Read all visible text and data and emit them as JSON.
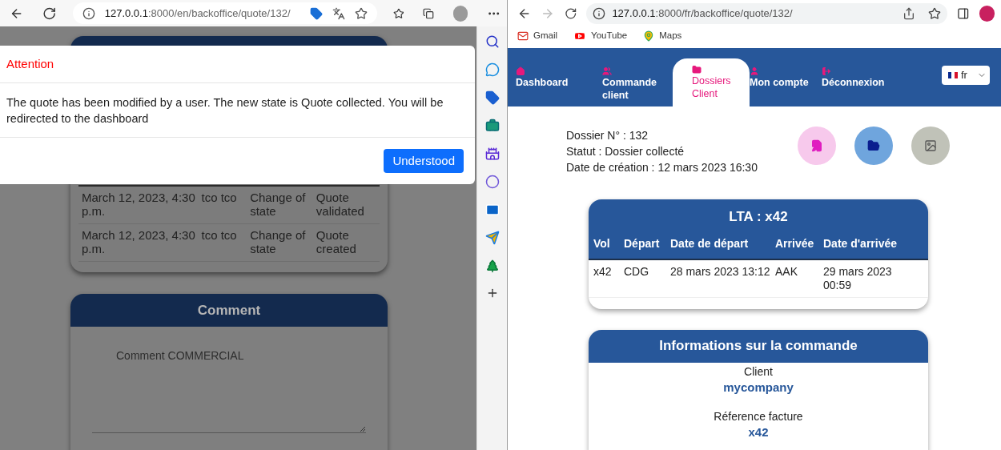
{
  "left_browser": {
    "address_host": "127.0.0.1",
    "address_path": ":8000/en/backoffice/quote/132/",
    "modal": {
      "title": "Attention",
      "message": "The quote has been modified by a user. The new state is Quote collected. You will be redirected to the dashboard",
      "button": "Understood"
    },
    "history_rows": [
      {
        "date": "March 12, 2023, 4:30 p.m.",
        "user": "tco tco",
        "action": "Change of state",
        "state": "Quote validated"
      },
      {
        "date": "March 12, 2023, 4:30 p.m.",
        "user": "tco tco",
        "action": "Change of state",
        "state": "Quote created"
      }
    ],
    "comment": {
      "title": "Comment",
      "value": "Comment COMMERCIAL"
    }
  },
  "right_browser": {
    "address_host": "127.0.0.1",
    "address_path": ":8000/fr/backoffice/quote/132/",
    "bookmarks": [
      "Gmail",
      "YouTube",
      "Maps"
    ],
    "nav": [
      {
        "label": "Dashboard",
        "selected": false
      },
      {
        "label": "Commande client",
        "selected": false
      },
      {
        "label": "Dossiers Client",
        "selected": true
      },
      {
        "label": "Mon compte",
        "selected": false
      },
      {
        "label": "Déconnexion",
        "selected": false
      }
    ],
    "language": "fr",
    "dossier_lines": [
      "Dossier N° : 132",
      "Statut : Dossier collecté",
      "Date de création : 12 mars 2023 16:30"
    ],
    "lta": {
      "title": "LTA : x42",
      "columns": [
        "Vol",
        "Départ",
        "Date de départ",
        "Arrivée",
        "Date d'arrivée"
      ],
      "rows": [
        [
          "x42",
          "CDG",
          "28 mars 2023 13:12",
          "AAK",
          "29 mars 2023 00:59"
        ]
      ]
    },
    "order_info": {
      "title": "Informations sur la commande",
      "fields": [
        {
          "label": "Client",
          "value": "mycompany"
        },
        {
          "label": "Réference facture",
          "value": "x42"
        }
      ]
    }
  }
}
